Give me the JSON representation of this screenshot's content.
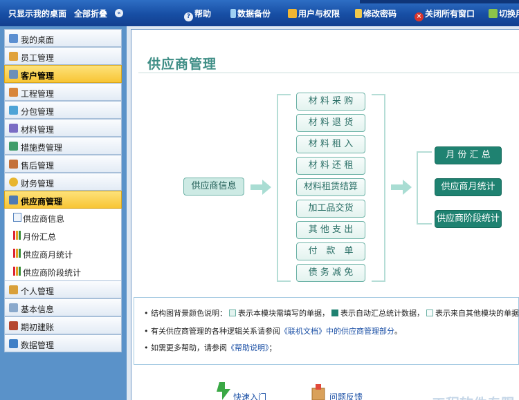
{
  "topbar": {
    "show_desktop": "只显示我的桌面",
    "collapse_all": "全部折叠",
    "help": "帮助",
    "backup": "数据备份",
    "users": "用户与权限",
    "password": "修改密码",
    "close_all": "关闭所有窗口",
    "switch_user": "切换用"
  },
  "sidebar": {
    "items": [
      {
        "label": "我的桌面",
        "icon": "desktop-icon"
      },
      {
        "label": "员工管理",
        "icon": "employee-icon"
      },
      {
        "label": "客户管理",
        "icon": "customer-icon"
      },
      {
        "label": "工程管理",
        "icon": "house-icon"
      },
      {
        "label": "分包管理",
        "icon": "subcontract-icon"
      },
      {
        "label": "材料管理",
        "icon": "material-icon"
      },
      {
        "label": "措施费管理",
        "icon": "measure-icon"
      },
      {
        "label": "售后管理",
        "icon": "aftersale-icon"
      },
      {
        "label": "财务管理",
        "icon": "finance-icon"
      },
      {
        "label": "供应商管理",
        "icon": "supplier-icon"
      }
    ],
    "sub_items": [
      {
        "label": "供应商信息",
        "icon": "document-icon"
      },
      {
        "label": "月份汇总",
        "icon": "bar-chart-icon"
      },
      {
        "label": "供应商月统计",
        "icon": "bar-chart-icon"
      },
      {
        "label": "供应商阶段统计",
        "icon": "bar-chart-icon"
      }
    ],
    "items_after": [
      {
        "label": "个人管理",
        "icon": "personal-icon"
      },
      {
        "label": "基本信息",
        "icon": "info-icon"
      },
      {
        "label": "期初建账",
        "icon": "ledger-icon"
      },
      {
        "label": "数据管理",
        "icon": "database-icon"
      }
    ]
  },
  "main": {
    "title": "供应商管理",
    "diagram": {
      "source": "供应商信息",
      "middle": [
        "材 料 采 购",
        "材 料 退 货",
        "材 料 租 入",
        "材 料 还 租",
        "材料租赁结算",
        "加工品交货",
        "其 他 支 出",
        "付　款　单",
        "债 务 减 免"
      ],
      "right": [
        "月 份 汇 总",
        "供应商月统计",
        "供应商阶段统计"
      ]
    },
    "notes": {
      "legend_prefix": "结构图背景颜色说明：",
      "legend_light": "表示本模块需填写的单据，",
      "legend_dark": "表示自动汇总统计数据，",
      "legend_mid": "表示来自其他模块的单据。",
      "line2_prefix": "有关供应商管理的各种逻辑关系请参阅",
      "line2_link": "《联机文档》中的供应商管理部分",
      "line2_suffix": "。",
      "line3_prefix": "如需更多帮助，请参阅",
      "line3_link": "《帮助说明》",
      "line3_suffix": "；"
    },
    "footer": {
      "quick_start": "快速入门",
      "feedback": "问题反馈",
      "watermark": "工程软件专限"
    }
  },
  "colors": {
    "accent": "#1f8271",
    "light_node": "#e3f3ef",
    "active_menu": "#f8c535",
    "topbar": "#174ea4"
  }
}
